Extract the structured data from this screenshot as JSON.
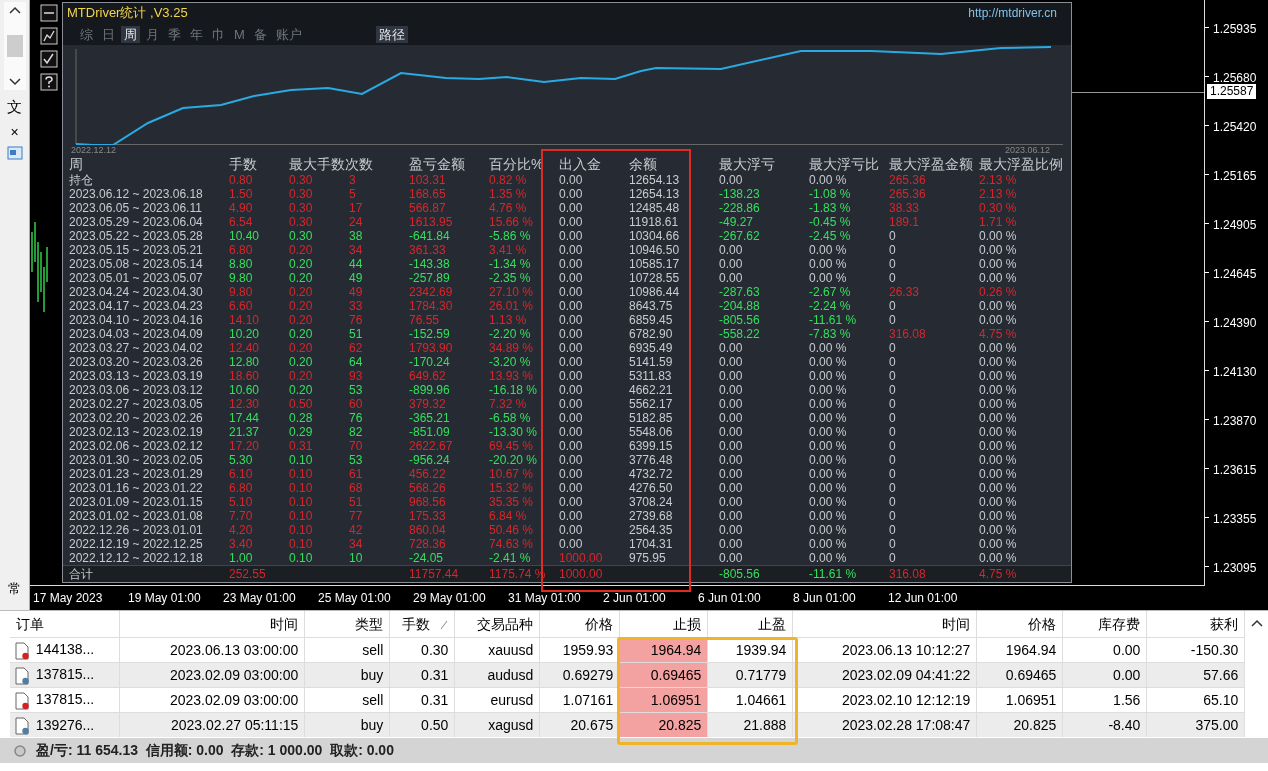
{
  "left_panel": {
    "label_top": "文",
    "close": "×",
    "label_bottom": "常"
  },
  "panel": {
    "title": "MTDriver统计 ,V3.25",
    "url": "http://mtdriver.cn",
    "tabs": [
      {
        "label": "综",
        "selected": false
      },
      {
        "label": "日",
        "selected": false
      },
      {
        "label": "周",
        "selected": true
      },
      {
        "label": "月",
        "selected": false
      },
      {
        "label": "季",
        "selected": false
      },
      {
        "label": "年",
        "selected": false
      },
      {
        "label": "巾",
        "selected": false
      },
      {
        "label": "M",
        "selected": false
      },
      {
        "label": "备",
        "selected": false
      },
      {
        "label": "账户",
        "selected": false
      }
    ],
    "path_button": "路径",
    "equity_chart": {
      "start_label": "2022.12.12",
      "end_label": "2023.06.12"
    },
    "stats": {
      "columns": [
        "周",
        "手数",
        "最大手数次数",
        "",
        "盈亏金额",
        "百分比%",
        "出入金",
        "余额",
        "最大浮亏",
        "最大浮亏比",
        "最大浮盈金额",
        "最大浮盈比例"
      ],
      "rows": [
        {
          "cells": [
            "持仓",
            "0.80",
            "0.30",
            "3",
            "103.31",
            "0.82 %",
            "0.00",
            "12654.13",
            "0.00",
            "0.00 %",
            "265.36",
            "2.13 %"
          ],
          "profit": true,
          "float_loss": false,
          "float_profit": true,
          "deposit_in": false
        },
        {
          "cells": [
            "2023.06.12 ~ 2023.06.18",
            "1.50",
            "0.30",
            "5",
            "168.65",
            "1.35 %",
            "0.00",
            "12654.13",
            "-138.23",
            "-1.08 %",
            "265.36",
            "2.13 %"
          ],
          "profit": true,
          "float_loss": true,
          "float_profit": true,
          "deposit_in": false
        },
        {
          "cells": [
            "2023.06.05 ~ 2023.06.11",
            "4.90",
            "0.30",
            "17",
            "566.87",
            "4.76 %",
            "0.00",
            "12485.48",
            "-228.86",
            "-1.83 %",
            "38.33",
            "0.30 %"
          ],
          "profit": true,
          "float_loss": true,
          "float_profit": true,
          "deposit_in": false
        },
        {
          "cells": [
            "2023.05.29 ~ 2023.06.04",
            "6.54",
            "0.30",
            "24",
            "1613.95",
            "15.66 %",
            "0.00",
            "11918.61",
            "-49.27",
            "-0.45 %",
            "189.1",
            "1.71 %"
          ],
          "profit": true,
          "float_loss": true,
          "float_profit": true,
          "deposit_in": false
        },
        {
          "cells": [
            "2023.05.22 ~ 2023.05.28",
            "10.40",
            "0.30",
            "38",
            "-641.84",
            "-5.86 %",
            "0.00",
            "10304.66",
            "-267.62",
            "-2.45 %",
            "0",
            "0.00 %"
          ],
          "profit": false,
          "float_loss": true,
          "float_profit": false,
          "deposit_in": false
        },
        {
          "cells": [
            "2023.05.15 ~ 2023.05.21",
            "6.80",
            "0.20",
            "34",
            "361.33",
            "3.41 %",
            "0.00",
            "10946.50",
            "0.00",
            "0.00 %",
            "0",
            "0.00 %"
          ],
          "profit": true,
          "float_loss": false,
          "float_profit": false,
          "deposit_in": false
        },
        {
          "cells": [
            "2023.05.08 ~ 2023.05.14",
            "8.80",
            "0.20",
            "44",
            "-143.38",
            "-1.34 %",
            "0.00",
            "10585.17",
            "0.00",
            "0.00 %",
            "0",
            "0.00 %"
          ],
          "profit": false,
          "float_loss": false,
          "float_profit": false,
          "deposit_in": false
        },
        {
          "cells": [
            "2023.05.01 ~ 2023.05.07",
            "9.80",
            "0.20",
            "49",
            "-257.89",
            "-2.35 %",
            "0.00",
            "10728.55",
            "0.00",
            "0.00 %",
            "0",
            "0.00 %"
          ],
          "profit": false,
          "float_loss": false,
          "float_profit": false,
          "deposit_in": false
        },
        {
          "cells": [
            "2023.04.24 ~ 2023.04.30",
            "9.80",
            "0.20",
            "49",
            "2342.69",
            "27.10 %",
            "0.00",
            "10986.44",
            "-287.63",
            "-2.67 %",
            "26.33",
            "0.26 %"
          ],
          "profit": true,
          "float_loss": true,
          "float_profit": true,
          "deposit_in": false
        },
        {
          "cells": [
            "2023.04.17 ~ 2023.04.23",
            "6.60",
            "0.20",
            "33",
            "1784.30",
            "26.01 %",
            "0.00",
            "8643.75",
            "-204.88",
            "-2.24 %",
            "0",
            "0.00 %"
          ],
          "profit": true,
          "float_loss": true,
          "float_profit": false,
          "deposit_in": false
        },
        {
          "cells": [
            "2023.04.10 ~ 2023.04.16",
            "14.10",
            "0.20",
            "76",
            "76.55",
            "1.13 %",
            "0.00",
            "6859.45",
            "-805.56",
            "-11.61 %",
            "0",
            "0.00 %"
          ],
          "profit": true,
          "float_loss": true,
          "float_profit": false,
          "deposit_in": false
        },
        {
          "cells": [
            "2023.04.03 ~ 2023.04.09",
            "10.20",
            "0.20",
            "51",
            "-152.59",
            "-2.20 %",
            "0.00",
            "6782.90",
            "-558.22",
            "-7.83 %",
            "316.08",
            "4.75 %"
          ],
          "profit": false,
          "float_loss": true,
          "float_profit": true,
          "deposit_in": false
        },
        {
          "cells": [
            "2023.03.27 ~ 2023.04.02",
            "12.40",
            "0.20",
            "62",
            "1793.90",
            "34.89 %",
            "0.00",
            "6935.49",
            "0.00",
            "0.00 %",
            "0",
            "0.00 %"
          ],
          "profit": true,
          "float_loss": false,
          "float_profit": false,
          "deposit_in": false
        },
        {
          "cells": [
            "2023.03.20 ~ 2023.03.26",
            "12.80",
            "0.20",
            "64",
            "-170.24",
            "-3.20 %",
            "0.00",
            "5141.59",
            "0.00",
            "0.00 %",
            "0",
            "0.00 %"
          ],
          "profit": false,
          "float_loss": false,
          "float_profit": false,
          "deposit_in": false
        },
        {
          "cells": [
            "2023.03.13 ~ 2023.03.19",
            "18.60",
            "0.20",
            "93",
            "649.62",
            "13.93 %",
            "0.00",
            "5311.83",
            "0.00",
            "0.00 %",
            "0",
            "0.00 %"
          ],
          "profit": true,
          "float_loss": false,
          "float_profit": false,
          "deposit_in": false
        },
        {
          "cells": [
            "2023.03.06 ~ 2023.03.12",
            "10.60",
            "0.20",
            "53",
            "-899.96",
            "-16.18 %",
            "0.00",
            "4662.21",
            "0.00",
            "0.00 %",
            "0",
            "0.00 %"
          ],
          "profit": false,
          "float_loss": false,
          "float_profit": false,
          "deposit_in": false
        },
        {
          "cells": [
            "2023.02.27 ~ 2023.03.05",
            "12.30",
            "0.50",
            "60",
            "379.32",
            "7.32 %",
            "0.00",
            "5562.17",
            "0.00",
            "0.00 %",
            "0",
            "0.00 %"
          ],
          "profit": true,
          "float_loss": false,
          "float_profit": false,
          "deposit_in": false
        },
        {
          "cells": [
            "2023.02.20 ~ 2023.02.26",
            "17.44",
            "0.28",
            "76",
            "-365.21",
            "-6.58 %",
            "0.00",
            "5182.85",
            "0.00",
            "0.00 %",
            "0",
            "0.00 %"
          ],
          "profit": false,
          "float_loss": false,
          "float_profit": false,
          "deposit_in": false
        },
        {
          "cells": [
            "2023.02.13 ~ 2023.02.19",
            "21.37",
            "0.29",
            "82",
            "-851.09",
            "-13.30 %",
            "0.00",
            "5548.06",
            "0.00",
            "0.00 %",
            "0",
            "0.00 %"
          ],
          "profit": false,
          "float_loss": false,
          "float_profit": false,
          "deposit_in": false
        },
        {
          "cells": [
            "2023.02.06 ~ 2023.02.12",
            "17.20",
            "0.31",
            "70",
            "2622.67",
            "69.45 %",
            "0.00",
            "6399.15",
            "0.00",
            "0.00 %",
            "0",
            "0.00 %"
          ],
          "profit": true,
          "float_loss": false,
          "float_profit": false,
          "deposit_in": false
        },
        {
          "cells": [
            "2023.01.30 ~ 2023.02.05",
            "5.30",
            "0.10",
            "53",
            "-956.24",
            "-20.20 %",
            "0.00",
            "3776.48",
            "0.00",
            "0.00 %",
            "0",
            "0.00 %"
          ],
          "profit": false,
          "float_loss": false,
          "float_profit": false,
          "deposit_in": false
        },
        {
          "cells": [
            "2023.01.23 ~ 2023.01.29",
            "6.10",
            "0.10",
            "61",
            "456.22",
            "10.67 %",
            "0.00",
            "4732.72",
            "0.00",
            "0.00 %",
            "0",
            "0.00 %"
          ],
          "profit": true,
          "float_loss": false,
          "float_profit": false,
          "deposit_in": false
        },
        {
          "cells": [
            "2023.01.16 ~ 2023.01.22",
            "6.80",
            "0.10",
            "68",
            "568.26",
            "15.32 %",
            "0.00",
            "4276.50",
            "0.00",
            "0.00 %",
            "0",
            "0.00 %"
          ],
          "profit": true,
          "float_loss": false,
          "float_profit": false,
          "deposit_in": false
        },
        {
          "cells": [
            "2023.01.09 ~ 2023.01.15",
            "5.10",
            "0.10",
            "51",
            "968.56",
            "35.35 %",
            "0.00",
            "3708.24",
            "0.00",
            "0.00 %",
            "0",
            "0.00 %"
          ],
          "profit": true,
          "float_loss": false,
          "float_profit": false,
          "deposit_in": false
        },
        {
          "cells": [
            "2023.01.02 ~ 2023.01.08",
            "7.70",
            "0.10",
            "77",
            "175.33",
            "6.84 %",
            "0.00",
            "2739.68",
            "0.00",
            "0.00 %",
            "0",
            "0.00 %"
          ],
          "profit": true,
          "float_loss": false,
          "float_profit": false,
          "deposit_in": false
        },
        {
          "cells": [
            "2022.12.26 ~ 2023.01.01",
            "4.20",
            "0.10",
            "42",
            "860.04",
            "50.46 %",
            "0.00",
            "2564.35",
            "0.00",
            "0.00 %",
            "0",
            "0.00 %"
          ],
          "profit": true,
          "float_loss": false,
          "float_profit": false,
          "deposit_in": false
        },
        {
          "cells": [
            "2022.12.19 ~ 2022.12.25",
            "3.40",
            "0.10",
            "34",
            "728.36",
            "74.63 %",
            "0.00",
            "1704.31",
            "0.00",
            "0.00 %",
            "0",
            "0.00 %"
          ],
          "profit": true,
          "float_loss": false,
          "float_profit": false,
          "deposit_in": false
        },
        {
          "cells": [
            "2022.12.12 ~ 2022.12.18",
            "1.00",
            "0.10",
            "10",
            "-24.05",
            "-2.41 %",
            "1000.00",
            "975.95",
            "0.00",
            "0.00 %",
            "0",
            "0.00 %"
          ],
          "profit": false,
          "float_loss": false,
          "float_profit": false,
          "deposit_in": true
        }
      ],
      "total": {
        "label": "合计",
        "lots": "252.55",
        "pnl": "11757.44",
        "pct": "1175.74 %",
        "deposit": "1000.00",
        "max_float_loss": "-805.56",
        "max_float_loss_pct": "-11.61 %",
        "max_float_profit": "316.08",
        "max_float_profit_pct": "4.75 %"
      }
    }
  },
  "price_axis": {
    "ticks": [
      "1.25935",
      "1.25680",
      "1.25420",
      "1.25165",
      "1.24905",
      "1.24645",
      "1.24390",
      "1.24130",
      "1.23870",
      "1.23615",
      "1.23355",
      "1.23095"
    ],
    "current": "1.25587"
  },
  "time_axis": [
    "17 May 2023",
    "19 May 01:00",
    "23 May 01:00",
    "25 May 01:00",
    "29 May 01:00",
    "31 May 01:00",
    "2 Jun 01:00",
    "6 Jun 01:00",
    "8 Jun 01:00",
    "12 Jun 01:00"
  ],
  "orders": {
    "columns": [
      {
        "label": "订单",
        "sorted": false
      },
      {
        "label": "时间",
        "sorted": false
      },
      {
        "label": "类型",
        "sorted": false
      },
      {
        "label": "手数",
        "sorted": true
      },
      {
        "label": "交易品种",
        "sorted": false
      },
      {
        "label": "价格",
        "sorted": false
      },
      {
        "label": "止损",
        "sorted": false
      },
      {
        "label": "止盈",
        "sorted": false
      },
      {
        "label": "时间",
        "sorted": false
      },
      {
        "label": "价格",
        "sorted": false
      },
      {
        "label": "库存费",
        "sorted": false
      },
      {
        "label": "获利",
        "sorted": false
      }
    ],
    "rows": [
      {
        "kind": "sell",
        "sl_marked": true,
        "cells": [
          "144138...",
          "2023.06.13 03:00:00",
          "sell",
          "0.30",
          "xauusd",
          "1959.93",
          "1964.94",
          "1939.94",
          "2023.06.13 10:12:27",
          "1964.94",
          "0.00",
          "-150.30"
        ]
      },
      {
        "kind": "buy",
        "sl_marked": true,
        "cells": [
          "137815...",
          "2023.02.09 03:00:00",
          "buy",
          "0.31",
          "audusd",
          "0.69279",
          "0.69465",
          "0.71779",
          "2023.02.09 04:41:22",
          "0.69465",
          "0.00",
          "57.66"
        ]
      },
      {
        "kind": "sell",
        "sl_marked": true,
        "cells": [
          "137815...",
          "2023.02.09 03:00:00",
          "sell",
          "0.31",
          "eurusd",
          "1.07161",
          "1.06951",
          "1.04661",
          "2023.02.10 12:12:19",
          "1.06951",
          "1.56",
          "65.10"
        ]
      },
      {
        "kind": "buy",
        "sl_marked": true,
        "cells": [
          "139276...",
          "2023.02.27 05:11:15",
          "buy",
          "0.50",
          "xagusd",
          "20.675",
          "20.825",
          "21.888",
          "2023.02.28 17:08:47",
          "20.825",
          "-8.40",
          "375.00"
        ]
      }
    ]
  },
  "status_bar": {
    "text": "盈/亏: 11 654.13  信用额: 0.00  存款: 1 000.00  取款: 0.00"
  }
}
